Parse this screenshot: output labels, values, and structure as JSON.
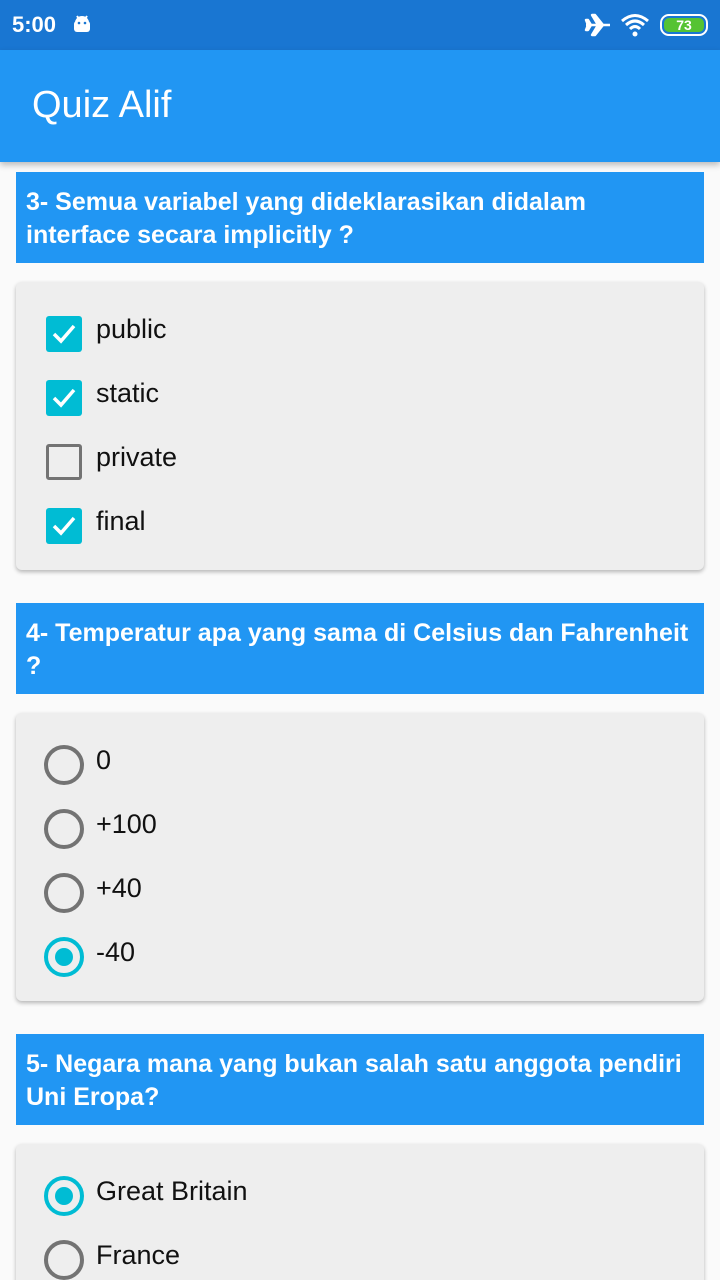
{
  "status_bar": {
    "time": "5:00",
    "battery": "73"
  },
  "app": {
    "title": "Quiz Alif"
  },
  "questions": [
    {
      "text": "3- Semua variabel yang dideklarasikan didalam interface secara implicitly ?",
      "type": "checkbox",
      "options": [
        {
          "label": "public",
          "checked": true
        },
        {
          "label": "static",
          "checked": true
        },
        {
          "label": "private",
          "checked": false
        },
        {
          "label": "final",
          "checked": true
        }
      ]
    },
    {
      "text": "4- Temperatur apa yang sama di Celsius dan Fahrenheit ?",
      "type": "radio",
      "options": [
        {
          "label": "0",
          "checked": false
        },
        {
          "label": "+100",
          "checked": false
        },
        {
          "label": "+40",
          "checked": false
        },
        {
          "label": "-40",
          "checked": true
        }
      ]
    },
    {
      "text": "5- Negara mana yang bukan salah satu anggota pendiri Uni Eropa?",
      "type": "radio",
      "options": [
        {
          "label": "Great Britain",
          "checked": true
        },
        {
          "label": "France",
          "checked": false
        }
      ]
    }
  ],
  "colors": {
    "primary": "#2196f3",
    "primary_dark": "#1976d2",
    "accent": "#00bcd4",
    "card": "#eeeeee"
  },
  "icons": [
    "android-icon",
    "airplane-mode-icon",
    "wifi-icon",
    "battery-icon",
    "check-icon"
  ]
}
